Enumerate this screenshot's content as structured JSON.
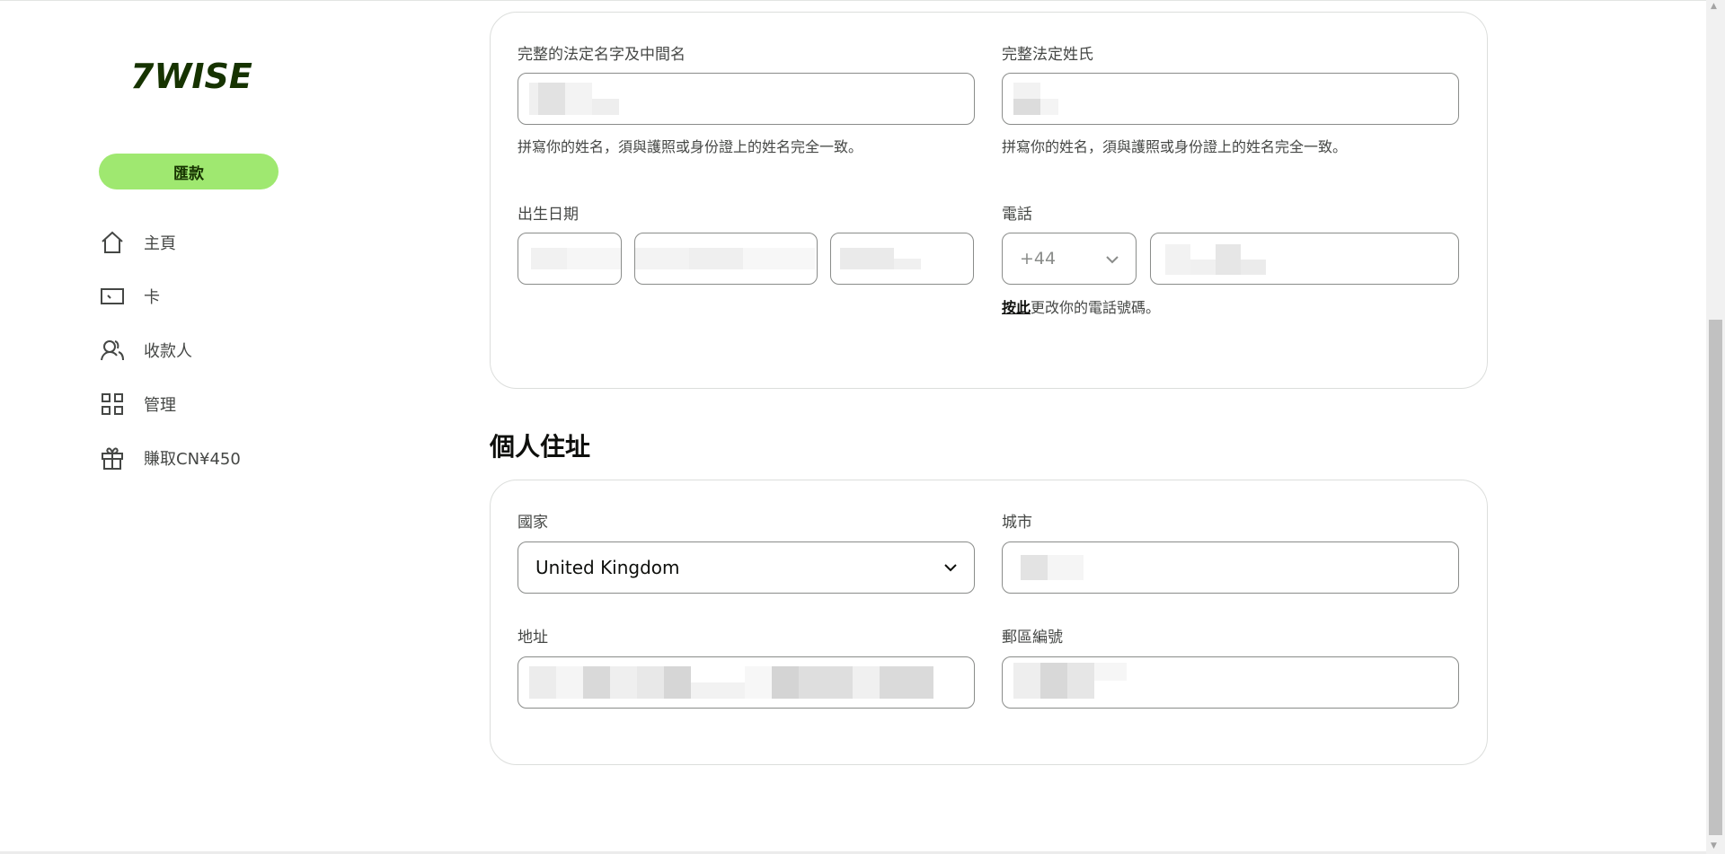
{
  "sidebar": {
    "brand": "7WISE",
    "send_button": "匯款",
    "nav": [
      {
        "label": "主頁",
        "icon": "home-icon"
      },
      {
        "label": "卡",
        "icon": "card-icon"
      },
      {
        "label": "收款人",
        "icon": "recipients-icon"
      },
      {
        "label": "管理",
        "icon": "manage-grid-icon"
      },
      {
        "label": "賺取CN¥450",
        "icon": "gift-icon"
      }
    ]
  },
  "personal": {
    "first_name_label": "完整的法定名字及中間名",
    "last_name_label": "完整法定姓氏",
    "name_help": "拼寫你的姓名，須與護照或身份證上的姓名完全一致。",
    "dob_label": "出生日期",
    "phone_label": "電話",
    "phone_prefix": "+44",
    "phone_help_link": "按此",
    "phone_help_text": "更改你的電話號碼。"
  },
  "address": {
    "section_title": "個人住址",
    "country_label": "國家",
    "country_value": "United Kingdom",
    "city_label": "城市",
    "address_label": "地址",
    "postcode_label": "郵區編號"
  },
  "colors": {
    "accent": "#9fe870",
    "brand_text": "#163300",
    "border": "#8a8c8a"
  }
}
